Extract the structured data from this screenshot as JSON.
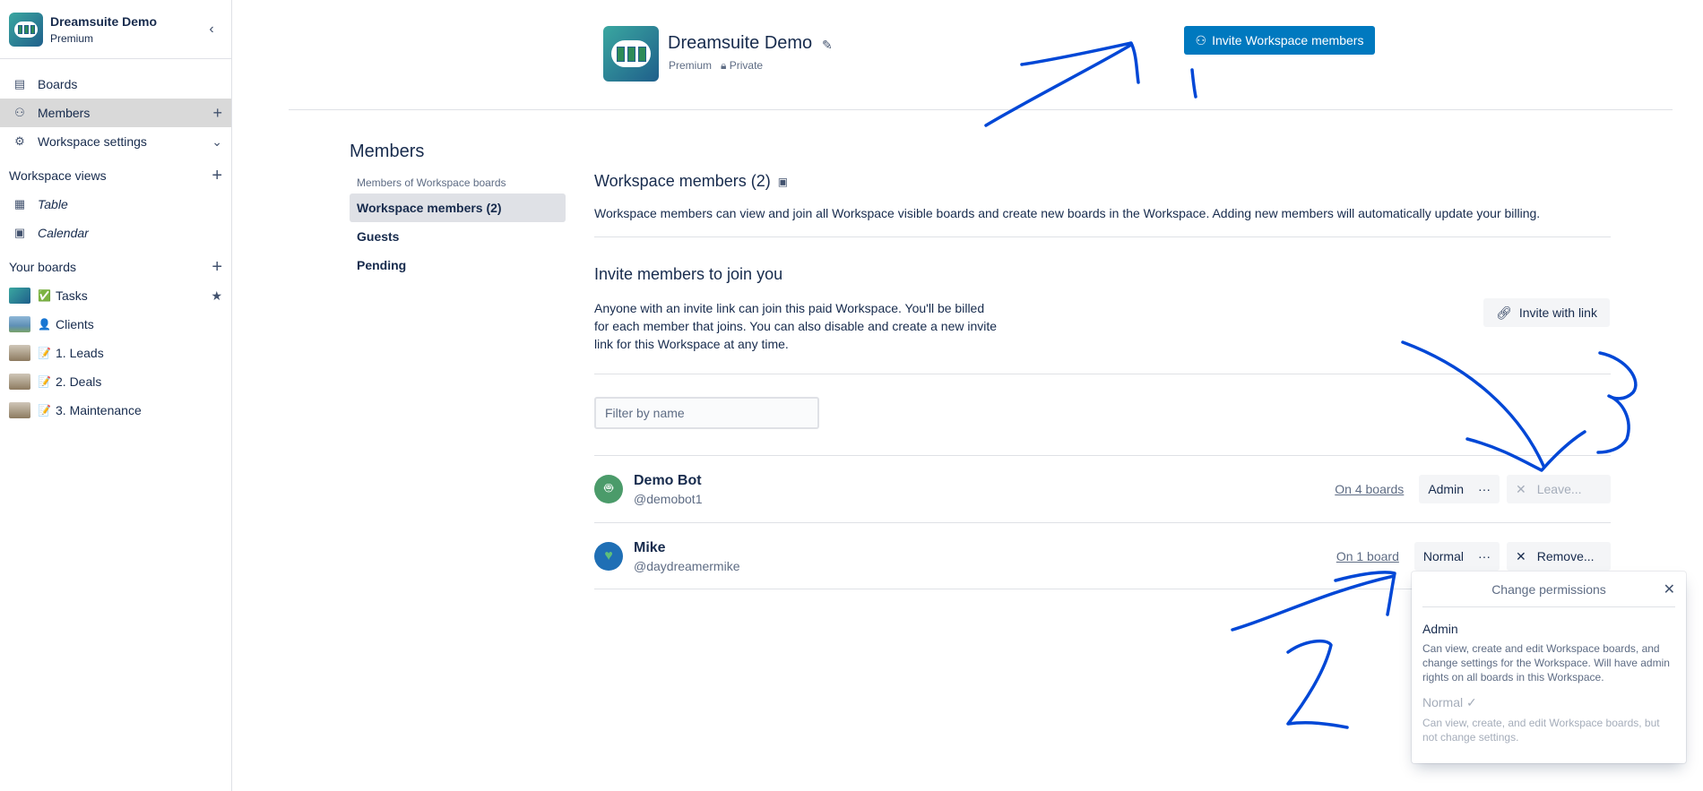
{
  "sidebar": {
    "workspace_name": "Dreamsuite Demo",
    "workspace_tier": "Premium",
    "collapse_icon": "chevron-left",
    "nav": [
      {
        "label": "Boards",
        "icon": "board-icon"
      },
      {
        "label": "Members",
        "icon": "person-icon",
        "action": "+"
      },
      {
        "label": "Workspace settings",
        "icon": "gear-icon",
        "action": "⌄"
      }
    ],
    "views_heading": "Workspace views",
    "views": [
      {
        "label": "Table",
        "icon": "table-icon"
      },
      {
        "label": "Calendar",
        "icon": "calendar-icon"
      }
    ],
    "boards_heading": "Your boards",
    "boards": [
      {
        "label": "Tasks",
        "emoji": "✅",
        "starred": true
      },
      {
        "label": "Clients",
        "emoji": "👤"
      },
      {
        "label": "1. Leads",
        "emoji": "📝"
      },
      {
        "label": "2. Deals",
        "emoji": "📝"
      },
      {
        "label": "3. Maintenance",
        "emoji": "📝"
      }
    ]
  },
  "header": {
    "title": "Dreamsuite Demo",
    "tier": "Premium",
    "visibility": "Private",
    "invite_button": "Invite Workspace members"
  },
  "subnav": {
    "heading": "Members",
    "items": [
      {
        "label": "Members of Workspace boards"
      },
      {
        "label": "Workspace members (2)"
      },
      {
        "label": "Guests"
      },
      {
        "label": "Pending"
      }
    ]
  },
  "main": {
    "heading": "Workspace members (2)",
    "description": "Workspace members can view and join all Workspace visible boards and create new boards in the Workspace. Adding new members will automatically update your billing.",
    "invite_heading": "Invite members to join you",
    "invite_description": "Anyone with an invite link can join this paid Workspace. You'll be billed for each member that joins. You can also disable and create a new invite link for this Workspace at any time.",
    "invite_link_button": "Invite with link",
    "filter_placeholder": "Filter by name",
    "members": [
      {
        "name": "Demo Bot",
        "handle": "@demobot1",
        "boards": "On 4 boards",
        "role": "Admin",
        "action": "Leave...",
        "action_enabled": false
      },
      {
        "name": "Mike",
        "handle": "@daydreamermike",
        "boards": "On 1 board",
        "role": "Normal",
        "action": "Remove...",
        "action_enabled": true
      }
    ]
  },
  "popover": {
    "title": "Change permissions",
    "options": [
      {
        "title": "Admin",
        "desc": "Can view, create and edit Workspace boards, and change settings for the Workspace. Will have admin rights on all boards in this Workspace."
      },
      {
        "title": "Normal ✓",
        "desc": "Can view, create, and edit Workspace boards, but not change settings."
      }
    ]
  },
  "colors": {
    "primary": "#0079bf",
    "annotation": "#0047d6"
  }
}
